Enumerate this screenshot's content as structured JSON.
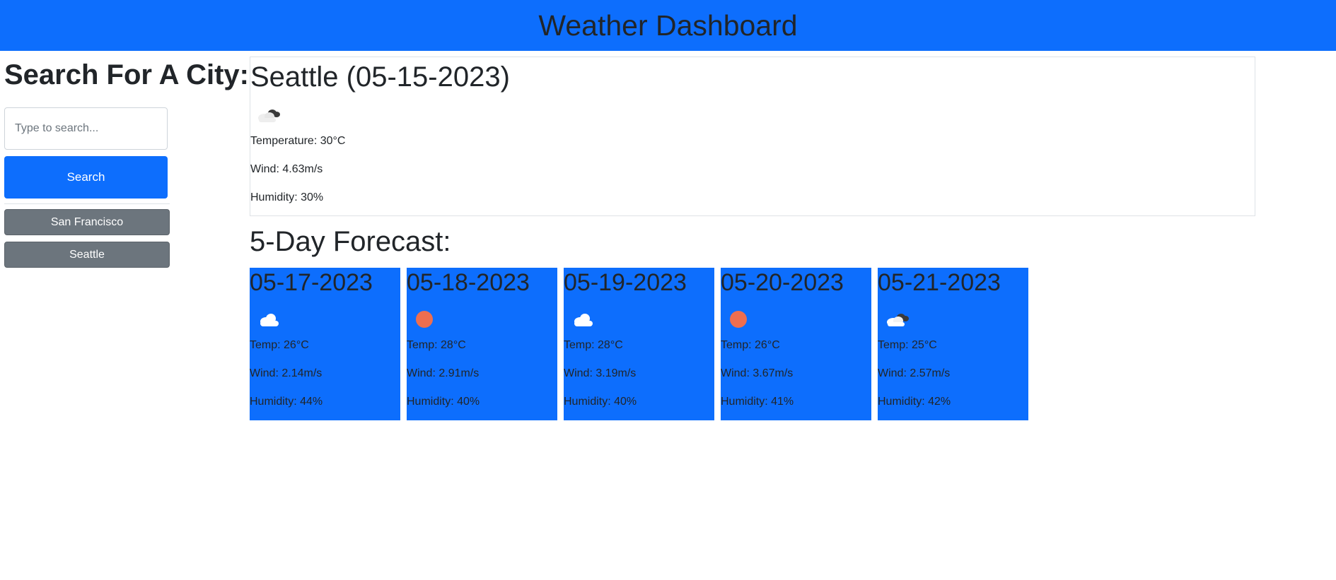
{
  "header": {
    "title": "Weather Dashboard"
  },
  "sidebar": {
    "heading": "Search For A City:",
    "search_placeholder": "Type to search...",
    "search_value": "",
    "search_button": "Search",
    "history": [
      "San Francisco",
      "Seattle"
    ]
  },
  "current": {
    "title": "Seattle (05-15-2023)",
    "icon": "broken-clouds-icon",
    "temperature": "Temperature: 30°C",
    "wind": "Wind: 4.63m/s",
    "humidity": "Humidity: 30%"
  },
  "forecast": {
    "heading": "5-Day Forecast:",
    "days": [
      {
        "date": "05-17-2023",
        "icon": "cloud-icon",
        "temp": "Temp: 26°C",
        "wind": "Wind: 2.14m/s",
        "humidity": "Humidity: 44%"
      },
      {
        "date": "05-18-2023",
        "icon": "sun-icon",
        "temp": "Temp: 28°C",
        "wind": "Wind: 2.91m/s",
        "humidity": "Humidity: 40%"
      },
      {
        "date": "05-19-2023",
        "icon": "cloud-icon",
        "temp": "Temp: 28°C",
        "wind": "Wind: 3.19m/s",
        "humidity": "Humidity: 40%"
      },
      {
        "date": "05-20-2023",
        "icon": "sun-icon",
        "temp": "Temp: 26°C",
        "wind": "Wind: 3.67m/s",
        "humidity": "Humidity: 41%"
      },
      {
        "date": "05-21-2023",
        "icon": "broken-clouds-icon",
        "temp": "Temp: 25°C",
        "wind": "Wind: 2.57m/s",
        "humidity": "Humidity: 42%"
      }
    ]
  },
  "colors": {
    "primary": "#0d6efd",
    "secondary": "#6c757d",
    "text": "#212529",
    "sun": "#ee6e4f"
  }
}
